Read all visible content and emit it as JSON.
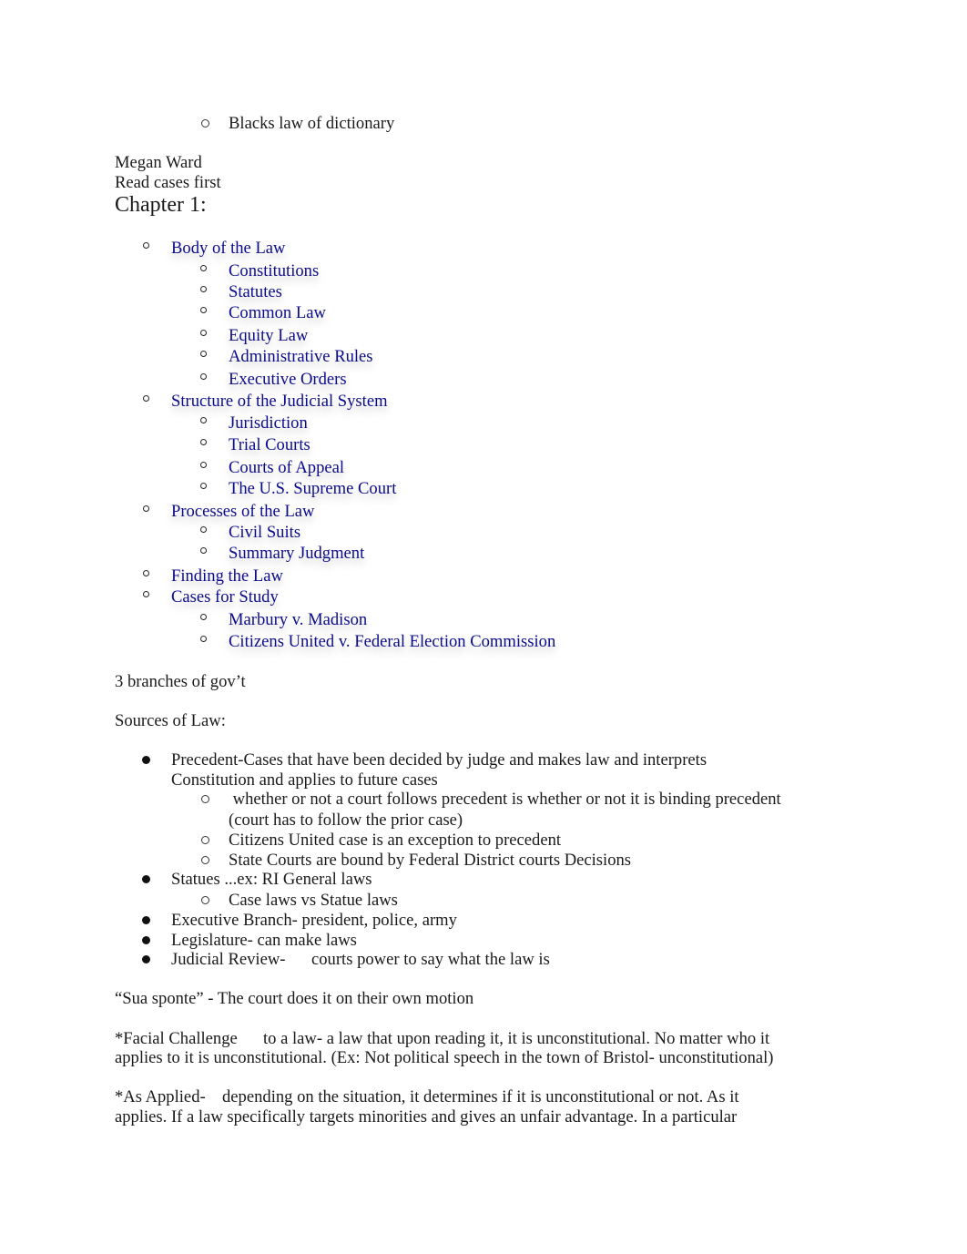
{
  "top_item": "Blacks law of dictionary",
  "author": "Megan Ward",
  "note": "Read cases first",
  "chapter_heading": "Chapter 1:",
  "toc": [
    {
      "label": "Body of the Law",
      "children": [
        "Constitutions",
        "Statutes",
        "Common Law",
        "Equity Law",
        "Administrative Rules",
        "Executive Orders"
      ]
    },
    {
      "label": "Structure of the Judicial System",
      "children": [
        "Jurisdiction",
        "Trial Courts",
        "Courts of Appeal",
        "The U.S. Supreme Court"
      ]
    },
    {
      "label": "Processes of the Law",
      "children": [
        "Civil Suits",
        "Summary Judgment"
      ]
    },
    {
      "label": "Finding the Law",
      "children": []
    },
    {
      "label": "Cases for Study",
      "children": [
        "Marbury v. Madison",
        "Citizens United v. Federal Election Commission"
      ]
    }
  ],
  "branches_line": "3 branches of gov’t",
  "sources_heading": "Sources of Law:",
  "sources": {
    "precedent_line1": "Precedent-Cases that have been decided by judge and makes law and interprets",
    "precedent_line2": "Constitution and applies to future cases",
    "precedent_sub1_line1": " whether or not a court follows precedent is whether or not it is binding precedent",
    "precedent_sub1_line2": "(court has to follow the prior case)",
    "precedent_sub2": "Citizens United case is an exception to precedent",
    "precedent_sub3": "State Courts are bound by Federal District courts Decisions",
    "statues": "Statues ...ex: RI General laws",
    "statues_sub": "Case laws vs Statue laws",
    "executive": "Executive Branch- president, police, army",
    "legislature": "Legislature- can make laws",
    "judicial_review_term": "Judicial Review-",
    "judicial_review_def": "courts power to say what the law is"
  },
  "sua_sponte": "“Sua sponte” - The court does it on their own motion",
  "facial": {
    "term": "*Facial Challenge",
    "line1_rest": "to a law- a law that upon reading it, it is unconstitutional. No matter who it",
    "line2": "applies to it is unconstitutional. (Ex: Not political speech in the town of Bristol- unconstitutional)"
  },
  "as_applied": {
    "term": "*As Applied-",
    "line1_rest": "depending on the situation, it determines if it is unconstitutional or not. As it",
    "line2": "applies. If a law specifically targets minorities and gives an unfair advantage. In a particular"
  }
}
